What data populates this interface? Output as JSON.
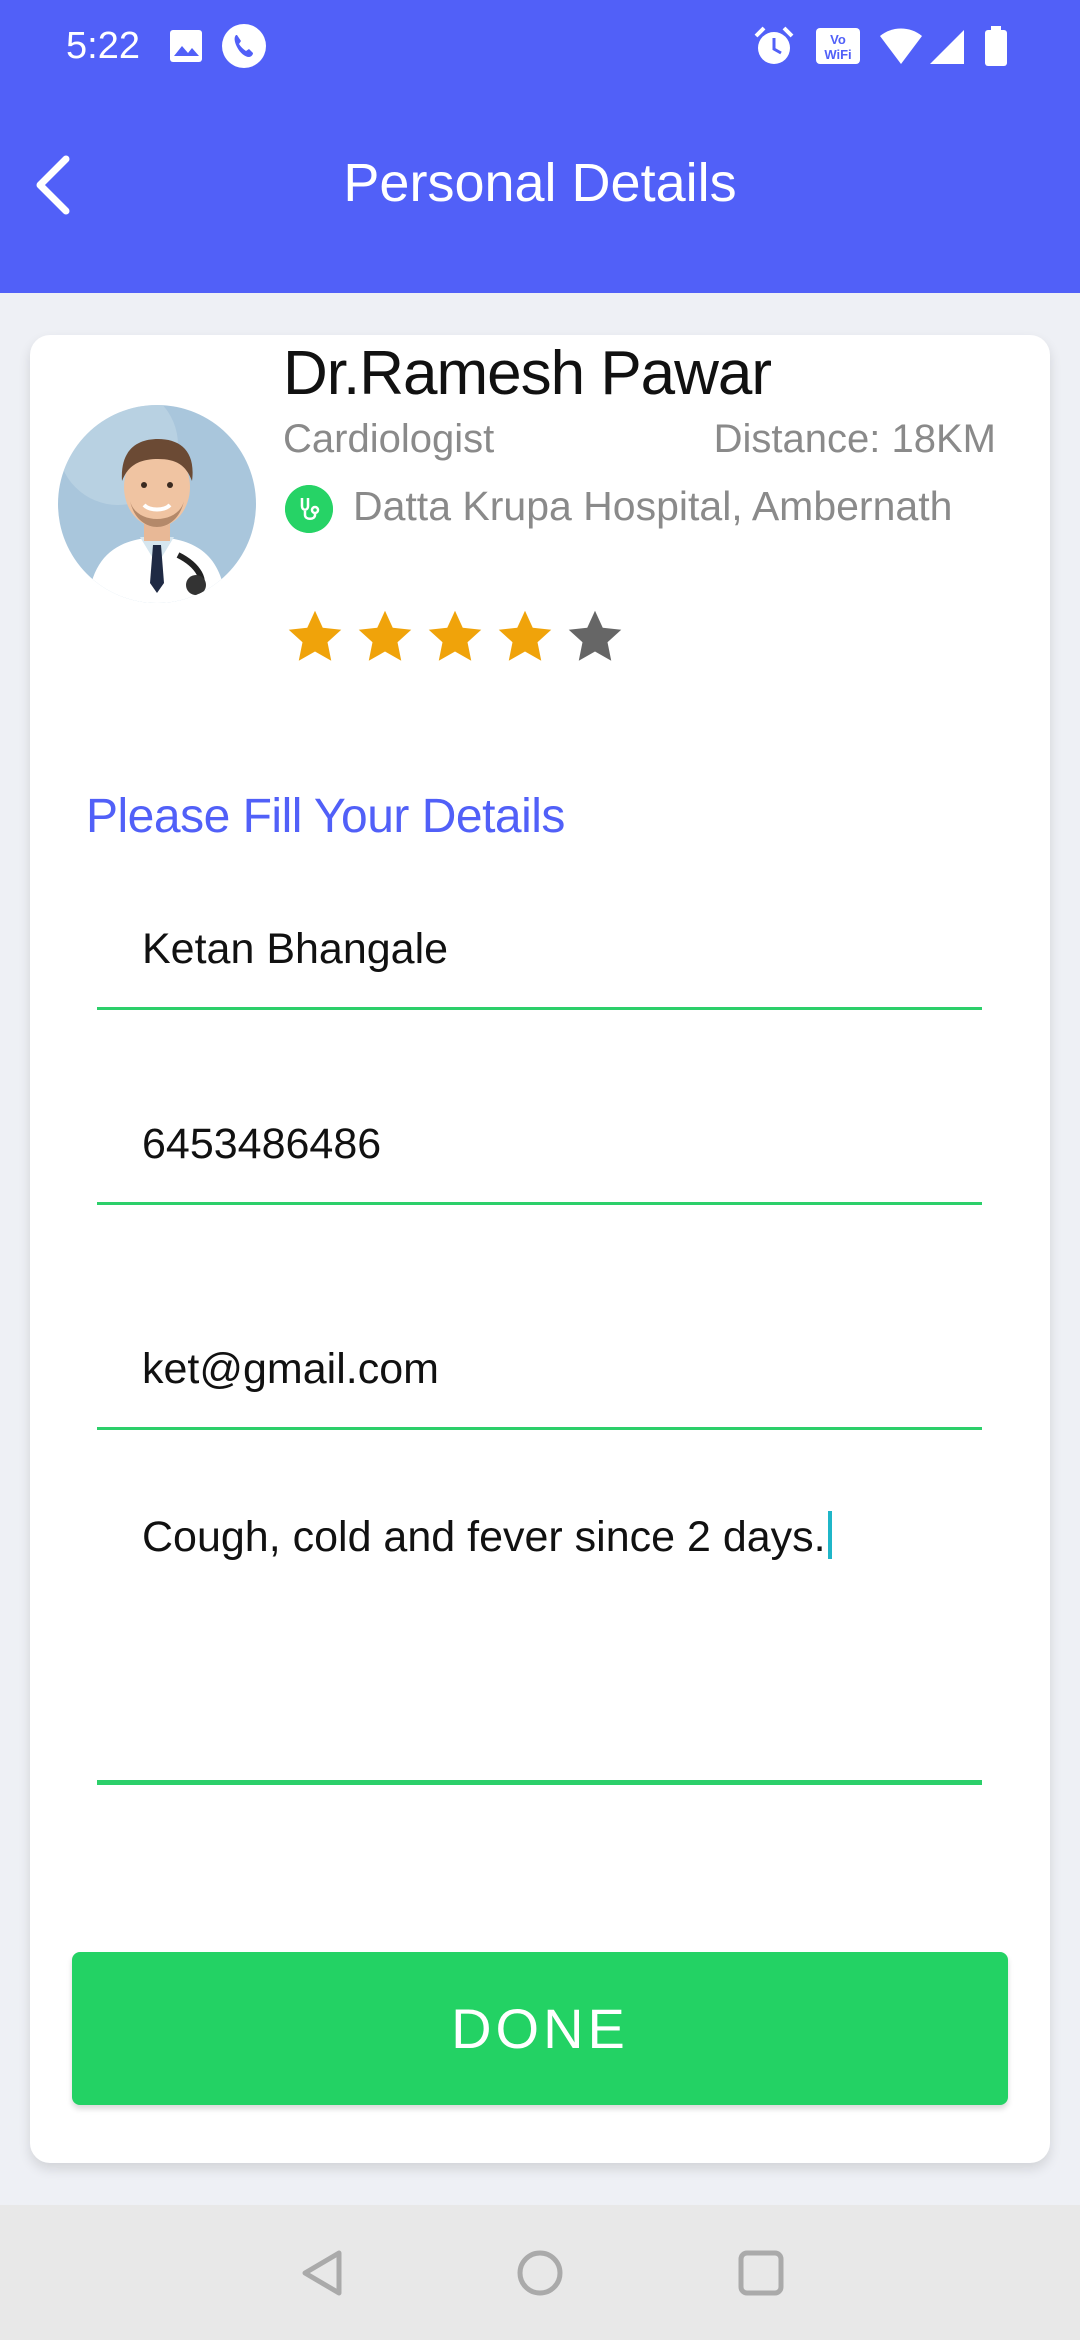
{
  "status_bar": {
    "time": "5:22",
    "icons": [
      "image-icon",
      "phone-call-icon",
      "alarm-icon",
      "vowifi-icon",
      "wifi-icon",
      "signal-icon",
      "battery-icon"
    ]
  },
  "app_bar": {
    "title": "Personal Details",
    "back_icon": "back-arrow-icon"
  },
  "doctor": {
    "name": "Dr.Ramesh Pawar",
    "specialty": "Cardiologist",
    "distance": "Distance: 18KM",
    "hospital": "Datta Krupa Hospital, Ambernath",
    "rating": 4,
    "rating_max": 5
  },
  "form": {
    "heading": "Please Fill Your Details",
    "name_value": "Ketan Bhangale",
    "phone_value": "6453486486",
    "email_value": "ket@gmail.com",
    "symptoms_value": "Cough, cold and fever since 2 days."
  },
  "done_label": "DONE",
  "colors": {
    "primary": "#5160f8",
    "accent_green": "#23d264",
    "star_filled": "#f0a30a",
    "star_empty": "#666666"
  }
}
